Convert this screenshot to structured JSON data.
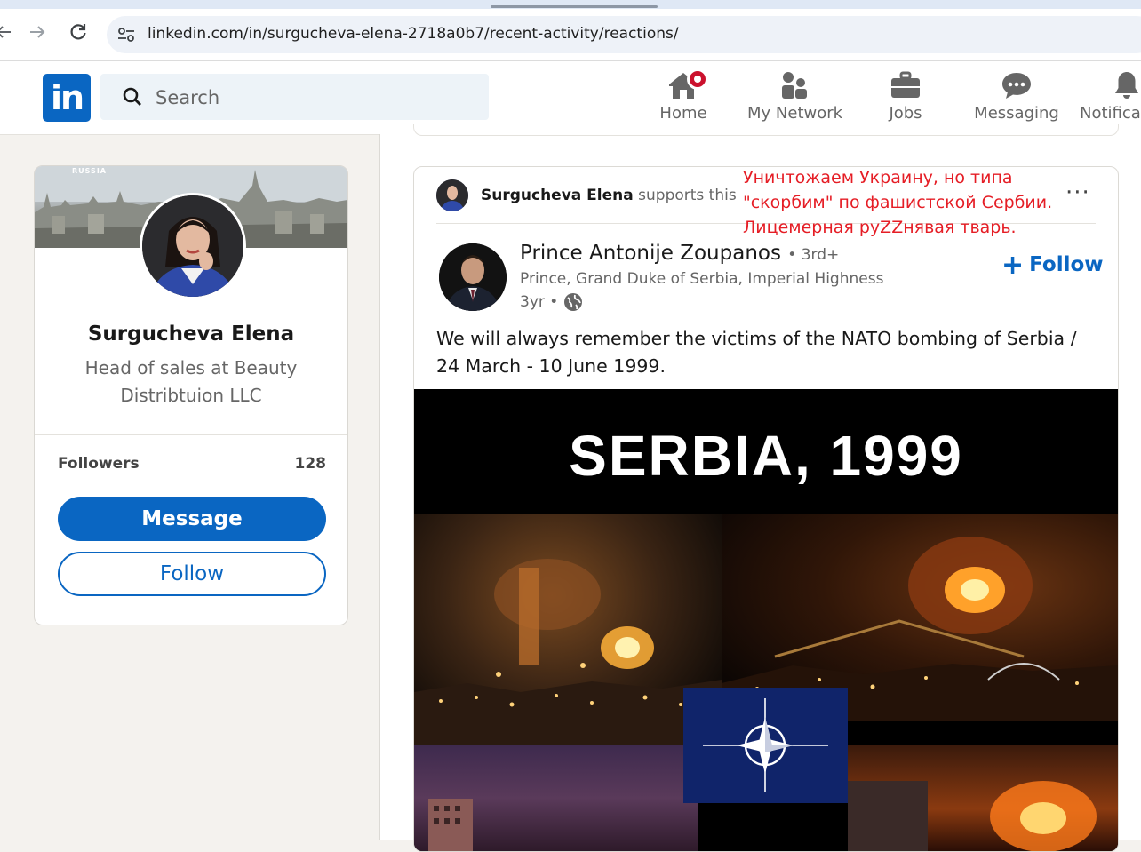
{
  "browser": {
    "back_icon": "arrow-left-icon",
    "forward_icon": "arrow-right-icon",
    "reload_icon": "reload-icon",
    "url": "linkedin.com/in/surgucheva-elena-2718a0b7/recent-activity/reactions/"
  },
  "header": {
    "logo_text": "in",
    "search_placeholder": "Search",
    "nav": [
      {
        "label": "Home",
        "icon": "home-icon"
      },
      {
        "label": "My Network",
        "icon": "people-icon"
      },
      {
        "label": "Jobs",
        "icon": "briefcase-icon"
      },
      {
        "label": "Messaging",
        "icon": "chat-icon"
      },
      {
        "label": "Notificat",
        "icon": "bell-icon"
      }
    ]
  },
  "profile": {
    "banner_text": "RUSSIA",
    "name": "Surgucheva Elena",
    "headline": "Head of sales at Beauty Distribtuion LLC",
    "followers_label": "Followers",
    "followers_count": "128",
    "message_label": "Message",
    "follow_label": "Follow"
  },
  "post": {
    "supporter_name": "Surgucheva Elena",
    "supporter_action": "supports this",
    "more_label": "···",
    "author_name": "Prince Antonije Zoupanos",
    "author_degree": "• 3rd+",
    "author_headline": "Prince, Grand Duke of Serbia, Imperial Highness",
    "time": "3yr •",
    "follow_plus": "+",
    "follow_label": "Follow",
    "text": "We will always remember the victims of the NATO bombing of Serbia / 24 March - 10 June 1999.",
    "image_title": "SERBIA, 1999"
  },
  "annotation": {
    "lines": [
      "Уничтожаем Украину, но типа",
      "\"скорбим\" по фашистской Сербии.",
      "Лицемерная руZZнявая тварь."
    ],
    "color": "#e51d25"
  },
  "colors": {
    "brand": "#0a66c2",
    "badge": "#cb112d"
  }
}
